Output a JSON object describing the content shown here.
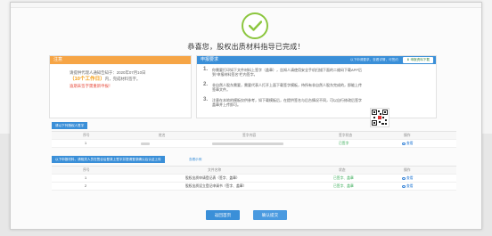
{
  "header": {
    "success_title": "恭喜您，股权出质材料指导已完成！"
  },
  "notice": {
    "title": "注意",
    "line1": "请提供代理人通知告知于：2020年07月10日",
    "line2_highlight": "（10个工作日）",
    "line2_rest": "内，完成材料签字。",
    "line3": "逾期未签字需重新申报！"
  },
  "procedure": {
    "title": "申报要求",
    "mid_link": "以下申请要求，查看详情，可签约",
    "download_button": "申报资料下载",
    "steps": [
      {
        "num": "1.",
        "text": "你需要打印如下文件材料上签字（盖章），告知人请使用安全手机扫描下面的二维码下载APP后到“申报材料签名”栏内签字。"
      },
      {
        "num": "2.",
        "text": "非自然人股东需要，需要代表人打开上面下载签字模板，待所有非自然人股东完成的，即能上传签章文件。"
      },
      {
        "num": "3.",
        "text": "注意在本地的模板仅供参考，如下载模板后，在提供签名与后台情况不同，可以自行修改后签字盖章并上传即可。"
      }
    ]
  },
  "table1": {
    "title": "请以下列授权人签字",
    "headers": [
      "序号",
      "姓名",
      "签字内容",
      "签字状态",
      "操作"
    ],
    "rows": [
      {
        "index": "1",
        "status": "已签字",
        "action": "查看"
      }
    ]
  },
  "table2": {
    "title": "以下申报材料，请相关人员在签合后登录上签字并提请登录确认后认证上传",
    "note": "查看示例",
    "headers": [
      "序号",
      "文件名称",
      "状态",
      "操作"
    ],
    "rows": [
      {
        "index": "1",
        "name": "股权出质申请登记表（签字、盖章）",
        "status": "已签字、盖章",
        "action": "查看"
      },
      {
        "index": "2",
        "name": "股权出质设立登记申请书（签字、盖章）",
        "status": "已签字、盖章",
        "action": "查看"
      }
    ]
  },
  "buttons": {
    "back": "返回首页",
    "confirm": "确认提交"
  },
  "colors": {
    "success_green": "#8cc63f",
    "accent_blue": "#3a8fd8",
    "notice_orange": "#f6a546",
    "warn_red": "#e74c3c"
  }
}
